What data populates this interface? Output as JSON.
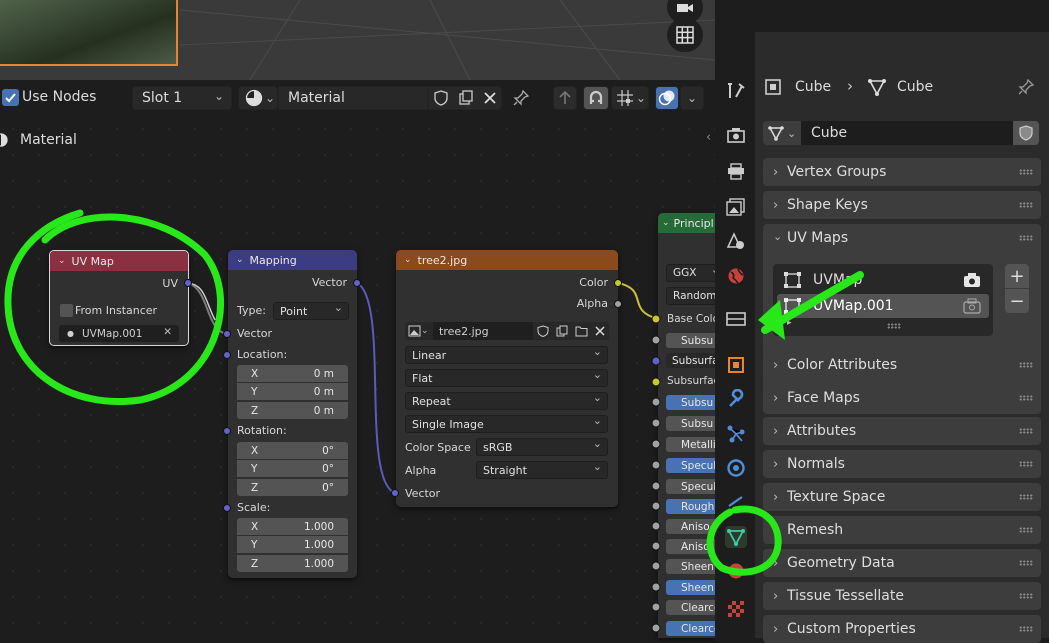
{
  "header": {
    "use_nodes_label": "Use Nodes",
    "slot_value": "Slot 1",
    "material_value": "Material"
  },
  "canvas": {
    "breadcrumb": "Material"
  },
  "nodes": {
    "uvmap": {
      "title": "UV Map",
      "output_uv": "UV",
      "from_instancer": "From Instancer",
      "uv_value": "UVMap.001"
    },
    "mapping": {
      "title": "Mapping",
      "output_vector": "Vector",
      "type_label": "Type:",
      "type_value": "Point",
      "input_vector": "Vector",
      "location_label": "Location:",
      "loc_x": "X",
      "loc_x_val": "0 m",
      "loc_y": "Y",
      "loc_y_val": "0 m",
      "loc_z": "Z",
      "loc_z_val": "0 m",
      "rotation_label": "Rotation:",
      "rot_x": "X",
      "rot_x_val": "0°",
      "rot_y": "Y",
      "rot_y_val": "0°",
      "rot_z": "Z",
      "rot_z_val": "0°",
      "scale_label": "Scale:",
      "sc_x": "X",
      "sc_x_val": "1.000",
      "sc_y": "Y",
      "sc_y_val": "1.000",
      "sc_z": "Z",
      "sc_z_val": "1.000"
    },
    "image": {
      "title": "tree2.jpg",
      "output_color": "Color",
      "output_alpha": "Alpha",
      "image_name": "tree2.jpg",
      "interpolation": "Linear",
      "projection": "Flat",
      "extension": "Repeat",
      "source": "Single Image",
      "color_space_label": "Color Space",
      "color_space_value": "sRGB",
      "alpha_label": "Alpha",
      "alpha_value": "Straight",
      "input_vector": "Vector"
    },
    "principled": {
      "title": "Principl",
      "distribution": "GGX",
      "subsurface_method": "Random",
      "base_color": "Base Colo",
      "subsurface": "Subsu",
      "subsurface_radius": "Subsurfa",
      "subsurface_color": "Subsurface",
      "rows": [
        "Subsu",
        "Subsu",
        "Metalli",
        "Specula",
        "Specul",
        "Roughn",
        "Aniso",
        "Aniso",
        "Sheen",
        "Sheen",
        "Clearco",
        "Clearco"
      ]
    }
  },
  "properties": {
    "object_name": "Cube",
    "mesh_name": "Cube",
    "datablock_value": "Cube",
    "panels": {
      "vertex_groups": "Vertex Groups",
      "shape_keys": "Shape Keys",
      "uv_maps": "UV Maps",
      "color_attributes": "Color Attributes",
      "face_maps": "Face Maps",
      "attributes": "Attributes",
      "normals": "Normals",
      "texture_space": "Texture Space",
      "remesh": "Remesh",
      "geometry_data": "Geometry Data",
      "tissue_tessellate": "Tissue Tessellate",
      "custom_properties": "Custom Properties"
    },
    "uv_list": [
      "UVMap",
      "UVMap.001"
    ],
    "add_label": "+",
    "remove_label": "−"
  },
  "colors": {
    "annotation": "#29e81a",
    "uvmap_header": "#8a3040",
    "mapping_header": "#3c3c83",
    "image_header": "#8a4a1e",
    "principled_header": "#266b37",
    "accent_blue": "#4772b3"
  }
}
